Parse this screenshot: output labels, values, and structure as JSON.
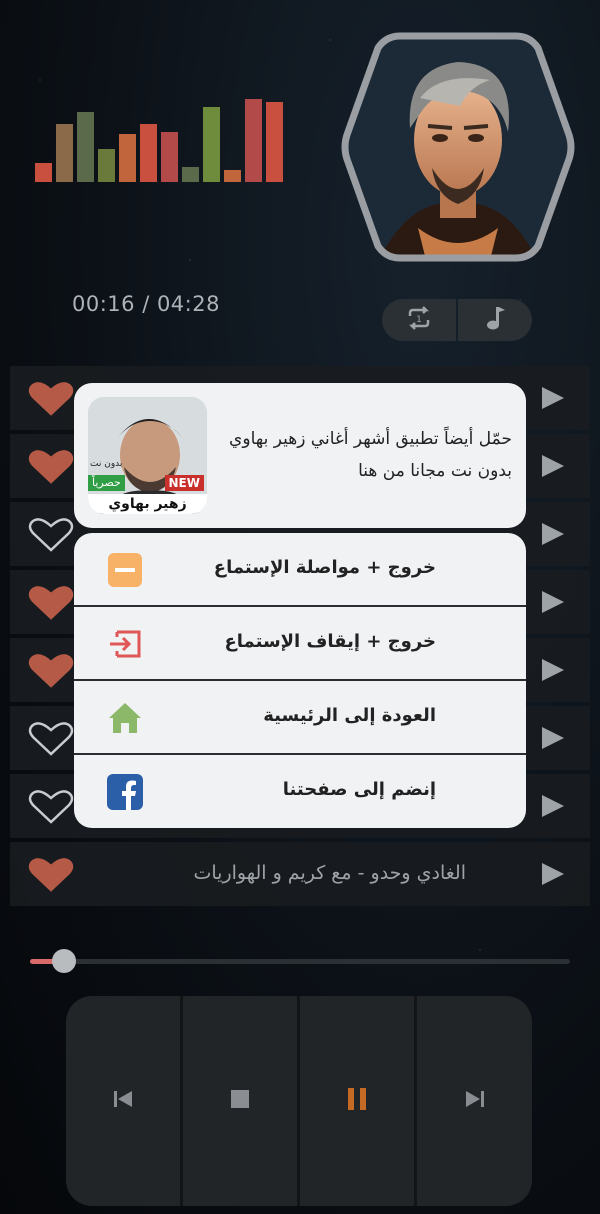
{
  "player": {
    "time_display": "00:16 / 04:28",
    "progress_fraction": 0.04,
    "equalizer_levels": [
      0.22,
      0.68,
      0.81,
      0.38,
      0.56,
      0.67,
      0.58,
      0.17,
      0.87,
      0.14,
      0.97,
      0.93
    ],
    "equalizer_colors": [
      "#c9503f",
      "#8b6a4a",
      "#5a6a4a",
      "#6a7a3a",
      "#c0653c",
      "#c9503f",
      "#b24a49",
      "#5b6a4a",
      "#6e8c3c",
      "#c0653c",
      "#b24a49",
      "#c9503f"
    ],
    "modes": {
      "repeat_icon": "repeat-one-icon",
      "music_icon": "music-note-icon"
    }
  },
  "playlist": [
    {
      "title": "",
      "favorite": true
    },
    {
      "title": "",
      "favorite": true
    },
    {
      "title": "",
      "favorite": false
    },
    {
      "title": "",
      "favorite": true
    },
    {
      "title": "",
      "favorite": true
    },
    {
      "title": "",
      "favorite": false
    },
    {
      "title": "",
      "favorite": false
    },
    {
      "title": "الغادي وحدو - مع كريم و الهواريات",
      "favorite": true
    }
  ],
  "promo": {
    "text": "حمّل أيضاً تطبيق أشهر أغاني زهير بهاوي بدون نت مجانا من هنا",
    "thumb_badge_new": "NEW",
    "thumb_badge_exclusive": "حصرياً",
    "thumb_caption_top": "بدون نت",
    "thumb_caption_name": "زهير بهاوي"
  },
  "menu": {
    "items": [
      {
        "label": "خروج + مواصلة الإستماع",
        "icon": "minimize-icon"
      },
      {
        "label": "خروج + إيقاف الإستماع",
        "icon": "exit-icon"
      },
      {
        "label": "العودة إلى الرئيسية",
        "icon": "home-icon"
      },
      {
        "label": "إنضم إلى صفحتنا",
        "icon": "facebook-icon"
      }
    ]
  },
  "colors": {
    "accent_heart": "#b55a46",
    "pause_accent": "#c46a24",
    "minimize_icon": "#f7b267",
    "exit_icon": "#e05555",
    "home_icon": "#8cb86a",
    "facebook_icon": "#2b5fa8"
  }
}
